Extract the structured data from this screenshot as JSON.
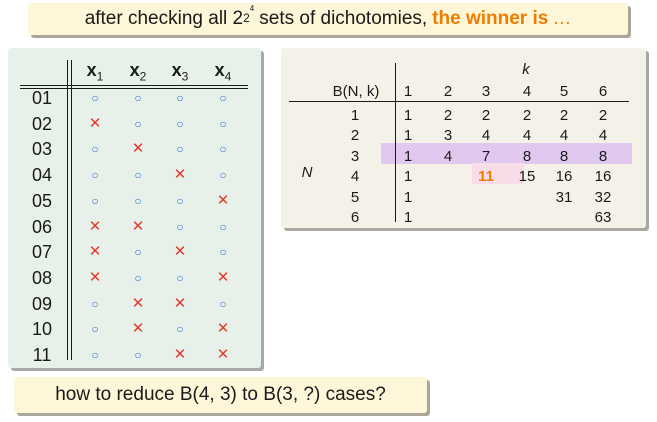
{
  "banner": {
    "prefix": "after checking all 2",
    "exp2": "2",
    "exp4": "4",
    "middle": " sets of dichotomies,",
    "highlight": "the winner is",
    "dots": "…"
  },
  "left_table": {
    "columns": [
      {
        "base": "x",
        "sub": "1"
      },
      {
        "base": "x",
        "sub": "2"
      },
      {
        "base": "x",
        "sub": "3"
      },
      {
        "base": "x",
        "sub": "4"
      }
    ],
    "rows": [
      {
        "label": "01",
        "cells": [
          "o",
          "o",
          "o",
          "o"
        ]
      },
      {
        "label": "02",
        "cells": [
          "x",
          "o",
          "o",
          "o"
        ]
      },
      {
        "label": "03",
        "cells": [
          "o",
          "x",
          "o",
          "o"
        ]
      },
      {
        "label": "04",
        "cells": [
          "o",
          "o",
          "x",
          "o"
        ]
      },
      {
        "label": "05",
        "cells": [
          "o",
          "o",
          "o",
          "x"
        ]
      },
      {
        "label": "06",
        "cells": [
          "x",
          "x",
          "o",
          "o"
        ]
      },
      {
        "label": "07",
        "cells": [
          "x",
          "o",
          "x",
          "o"
        ]
      },
      {
        "label": "08",
        "cells": [
          "x",
          "o",
          "o",
          "x"
        ]
      },
      {
        "label": "09",
        "cells": [
          "o",
          "x",
          "x",
          "o"
        ]
      },
      {
        "label": "10",
        "cells": [
          "o",
          "x",
          "o",
          "x"
        ]
      },
      {
        "label": "11",
        "cells": [
          "o",
          "o",
          "x",
          "x"
        ]
      }
    ],
    "symbols": {
      "o": "○",
      "x": "✕"
    },
    "colors": {
      "o": "#2b6fd9",
      "x": "#e23b2e"
    }
  },
  "right_table": {
    "k_label": "k",
    "corner_label": "B(N, k)",
    "n_label": "N",
    "k_values": [
      "1",
      "2",
      "3",
      "4",
      "5",
      "6"
    ],
    "rows": [
      {
        "n": "1",
        "values": [
          "1",
          "2",
          "2",
          "2",
          "2",
          "2"
        ]
      },
      {
        "n": "2",
        "values": [
          "1",
          "3",
          "4",
          "4",
          "4",
          "4"
        ]
      },
      {
        "n": "3",
        "values": [
          "1",
          "4",
          "7",
          "8",
          "8",
          "8"
        ]
      },
      {
        "n": "4",
        "values": [
          "1",
          "",
          "11",
          "15",
          "16",
          "16"
        ]
      },
      {
        "n": "5",
        "values": [
          "1",
          "",
          "",
          "",
          "31",
          "32"
        ]
      },
      {
        "n": "6",
        "values": [
          "1",
          "",
          "",
          "",
          "",
          "63"
        ]
      }
    ],
    "highlight_row_color": "#e1c8ef",
    "highlight_cell_color": "#f8dde8",
    "winner_color": "#f07d00"
  },
  "bottom": {
    "text": "how to reduce B(4, 3) to B(3, ?) cases?"
  }
}
